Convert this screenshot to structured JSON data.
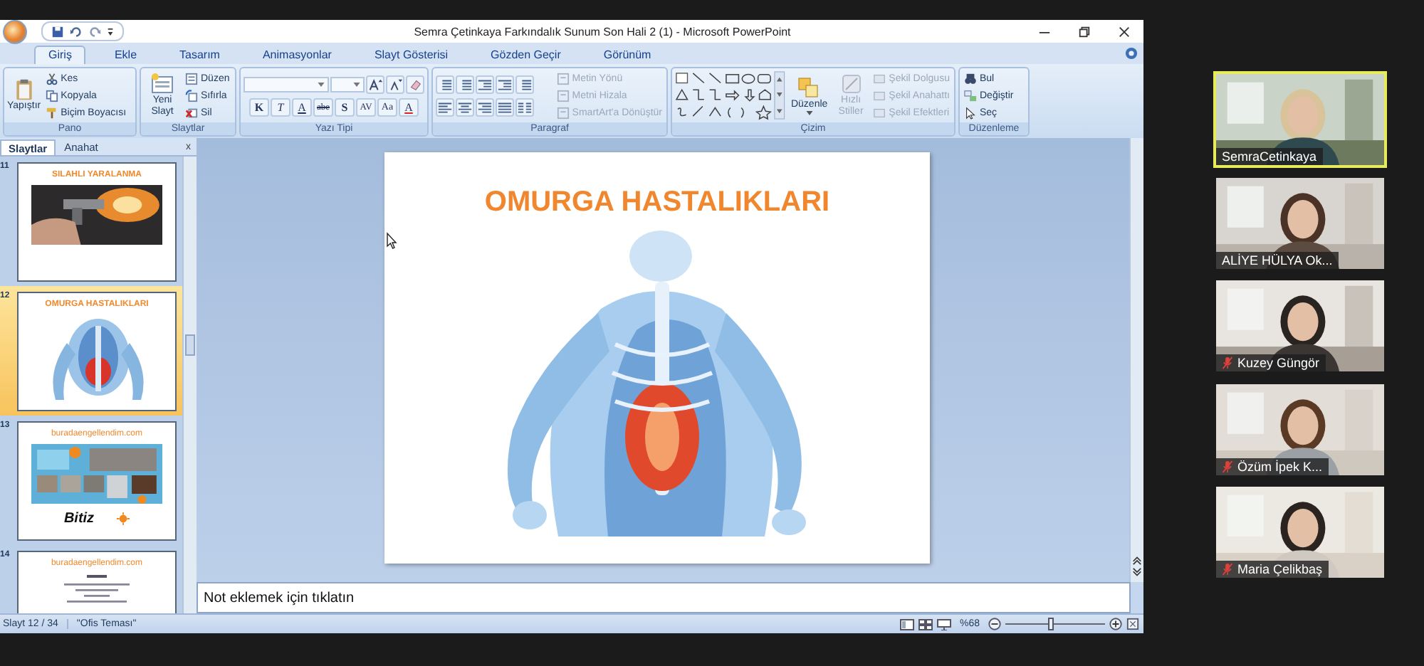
{
  "window": {
    "title": "Semra Çetinkaya Farkındalık Sunum Son Hali 2 (1) - Microsoft PowerPoint"
  },
  "tabs": [
    {
      "label": "Giriş",
      "selected": true
    },
    {
      "label": "Ekle",
      "selected": false
    },
    {
      "label": "Tasarım",
      "selected": false
    },
    {
      "label": "Animasyonlar",
      "selected": false
    },
    {
      "label": "Slayt Gösterisi",
      "selected": false
    },
    {
      "label": "Gözden Geçir",
      "selected": false
    },
    {
      "label": "Görünüm",
      "selected": false
    }
  ],
  "ribbon": {
    "pano": {
      "label": "Pano",
      "paste": "Yapıştır",
      "items": [
        "Kes",
        "Kopyala",
        "Biçim Boyacısı"
      ]
    },
    "slaytlar": {
      "label": "Slaytlar",
      "new_slide": "Yeni Slayt",
      "items": [
        "Düzen",
        "Sıfırla",
        "Sil"
      ]
    },
    "yazi_tipi": {
      "label": "Yazı Tipi",
      "format_buttons": [
        "K",
        "T",
        "A",
        "abe",
        "S",
        "AV",
        "Aa",
        "A"
      ]
    },
    "paragraf": {
      "label": "Paragraf",
      "items": [
        {
          "label": "Metin Yönü",
          "disabled": true
        },
        {
          "label": "Metni Hizala",
          "disabled": true
        },
        {
          "label": "SmartArt'a Dönüştür",
          "disabled": true
        }
      ]
    },
    "cizim": {
      "label": "Çizim",
      "arrange": "Düzenle",
      "quick_styles": {
        "label": "Hızlı Stiller",
        "disabled": true
      },
      "items": [
        {
          "label": "Şekil Dolgusu",
          "disabled": true
        },
        {
          "label": "Şekil Anahattı",
          "disabled": true
        },
        {
          "label": "Şekil Efektleri",
          "disabled": true
        }
      ]
    },
    "duzenleme": {
      "label": "Düzenleme",
      "items": [
        "Bul",
        "Değiştir",
        "Seç"
      ]
    }
  },
  "panel": {
    "tabs": [
      {
        "label": "Slaytlar",
        "selected": true
      },
      {
        "label": "Anahat",
        "selected": false
      }
    ],
    "close": "x"
  },
  "slides": [
    {
      "number": "11",
      "selected": false,
      "title": "SILAHLI YARALANMA"
    },
    {
      "number": "12",
      "selected": true,
      "title": "OMURGA HASTALIKLARI",
      "kind": "figure"
    },
    {
      "number": "13",
      "selected": false,
      "title": "buradaengellendim.com",
      "kind": "collage",
      "caption": "Bitiz"
    },
    {
      "number": "14",
      "selected": false,
      "title": "buradaengellendim.com",
      "kind": "text"
    }
  ],
  "slide": {
    "title": "OMURGA HASTALIKLARI"
  },
  "notes": {
    "placeholder": "Not eklemek için tıklatın"
  },
  "status_bar": {
    "slide": "Slayt 12 / 34",
    "theme": "\"Ofis Teması\"",
    "zoom": "%68",
    "zoom_slider": {
      "level": 0.45
    }
  },
  "participants": [
    {
      "name": "SemraCetinkaya",
      "muted": false,
      "speaking": true
    },
    {
      "name": "ALİYE HÜLYA Ok...",
      "muted": false,
      "speaking": false
    },
    {
      "name": "Kuzey Güngör",
      "muted": true,
      "speaking": false
    },
    {
      "name": "Özüm İpek K...",
      "muted": true,
      "speaking": false
    },
    {
      "name": "Maria Çelikbaş",
      "muted": true,
      "speaking": false
    }
  ]
}
